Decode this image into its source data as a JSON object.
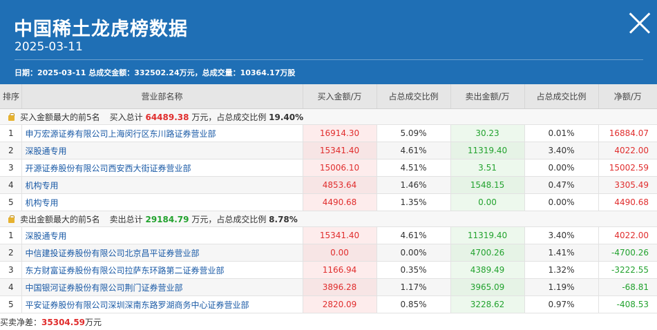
{
  "header": {
    "title": "中国稀土龙虎榜数据",
    "date": "2025-03-11",
    "summary": "日期：2025-03-11 总成交金额：332502.24万元，总成交量：10364.17万股"
  },
  "columns": [
    "排序",
    "营业部名称",
    "买入金额/万",
    "占总成交比例",
    "卖出金额/万",
    "占总成交比例",
    "净额/万"
  ],
  "buy_section": {
    "label": "买入金额最大的前5名",
    "total_label": "买入总计",
    "total_value": "64489.38",
    "unit_text": "万元，占总成交比例",
    "ratio": "19.40%",
    "rows": [
      {
        "idx": "1",
        "name": "申万宏源证券有限公司上海闵行区东川路证券营业部",
        "buy": "16914.30",
        "buy_ratio": "5.09%",
        "sell": "30.23",
        "sell_ratio": "0.01%",
        "net": "16884.07",
        "net_color": "red"
      },
      {
        "idx": "2",
        "name": "深股通专用",
        "buy": "15341.40",
        "buy_ratio": "4.61%",
        "sell": "11319.40",
        "sell_ratio": "3.40%",
        "net": "4022.00",
        "net_color": "red"
      },
      {
        "idx": "3",
        "name": "开源证券股份有限公司西安西大街证券营业部",
        "buy": "15006.10",
        "buy_ratio": "4.51%",
        "sell": "3.51",
        "sell_ratio": "0.00%",
        "net": "15002.59",
        "net_color": "red"
      },
      {
        "idx": "4",
        "name": "机构专用",
        "buy": "4853.64",
        "buy_ratio": "1.46%",
        "sell": "1548.15",
        "sell_ratio": "0.47%",
        "net": "3305.49",
        "net_color": "red"
      },
      {
        "idx": "5",
        "name": "机构专用",
        "buy": "4490.68",
        "buy_ratio": "1.35%",
        "sell": "0.00",
        "sell_ratio": "0.00%",
        "net": "4490.68",
        "net_color": "red"
      }
    ]
  },
  "sell_section": {
    "label": "卖出金额最大的前5名",
    "total_label": "卖出总计",
    "total_value": "29184.79",
    "unit_text": "万元，占总成交比例",
    "ratio": "8.78%",
    "rows": [
      {
        "idx": "1",
        "name": "深股通专用",
        "buy": "15341.40",
        "buy_ratio": "4.61%",
        "sell": "11319.40",
        "sell_ratio": "3.40%",
        "net": "4022.00",
        "net_color": "red"
      },
      {
        "idx": "2",
        "name": "中信建投证券股份有限公司北京昌平证券营业部",
        "buy": "0.00",
        "buy_ratio": "0.00%",
        "sell": "4700.26",
        "sell_ratio": "1.41%",
        "net": "-4700.26",
        "net_color": "green"
      },
      {
        "idx": "3",
        "name": "东方财富证券股份有限公司拉萨东环路第二证券营业部",
        "buy": "1166.94",
        "buy_ratio": "0.35%",
        "sell": "4389.49",
        "sell_ratio": "1.32%",
        "net": "-3222.55",
        "net_color": "green"
      },
      {
        "idx": "4",
        "name": "中国银河证券股份有限公司荆门证券营业部",
        "buy": "3896.28",
        "buy_ratio": "1.17%",
        "sell": "3965.09",
        "sell_ratio": "1.19%",
        "net": "-68.81",
        "net_color": "green"
      },
      {
        "idx": "5",
        "name": "平安证券股份有限公司深圳深南东路罗湖商务中心证券营业部",
        "buy": "2820.09",
        "buy_ratio": "0.85%",
        "sell": "3228.62",
        "sell_ratio": "0.97%",
        "net": "-408.53",
        "net_color": "green"
      }
    ]
  },
  "footer": {
    "label": "买卖净差：",
    "value": "35304.59",
    "unit": "万元"
  },
  "colors": {
    "header_bg": "#1f6fb5",
    "buy_red": "#e02d2d",
    "sell_green": "#22a22e",
    "link_blue": "#1a5aa6"
  }
}
